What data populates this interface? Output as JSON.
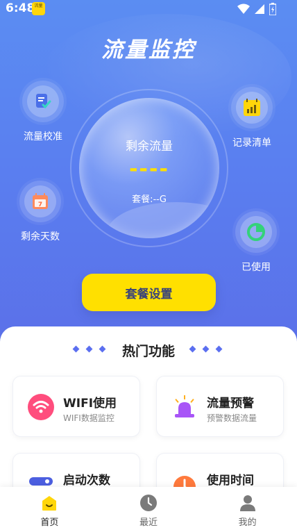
{
  "status": {
    "time": "6:48",
    "app_badge": "流量"
  },
  "header": {
    "title": "流量监控"
  },
  "features": {
    "calibrate": "流量校准",
    "records": "记录清单",
    "days_left": "剩余天数",
    "used": "已使用"
  },
  "bubble": {
    "label": "剩余流量",
    "value": "----",
    "plan": "套餐:--G"
  },
  "plan_button": "套餐设置",
  "section": {
    "title": "热门功能"
  },
  "cards": [
    {
      "title": "WIFI使用",
      "sub": "WIFI数据监控",
      "icon": "wifi-icon",
      "color": "#ff4d7d"
    },
    {
      "title": "流量预警",
      "sub": "预警数据流量",
      "icon": "alarm-icon",
      "color": "#a855f7"
    },
    {
      "title": "启动次数",
      "sub": "",
      "icon": "toggle-icon",
      "color": "#4c5fe0"
    },
    {
      "title": "使用时间",
      "sub": "",
      "icon": "clock-icon",
      "color": "#ff7a3d"
    }
  ],
  "nav": [
    {
      "label": "首页",
      "icon": "home-icon",
      "active": true
    },
    {
      "label": "最近",
      "icon": "clock-icon",
      "active": false
    },
    {
      "label": "我的",
      "icon": "user-icon",
      "active": false
    }
  ],
  "colors": {
    "primary": "#5b7ff0",
    "accent": "#ffe000"
  }
}
